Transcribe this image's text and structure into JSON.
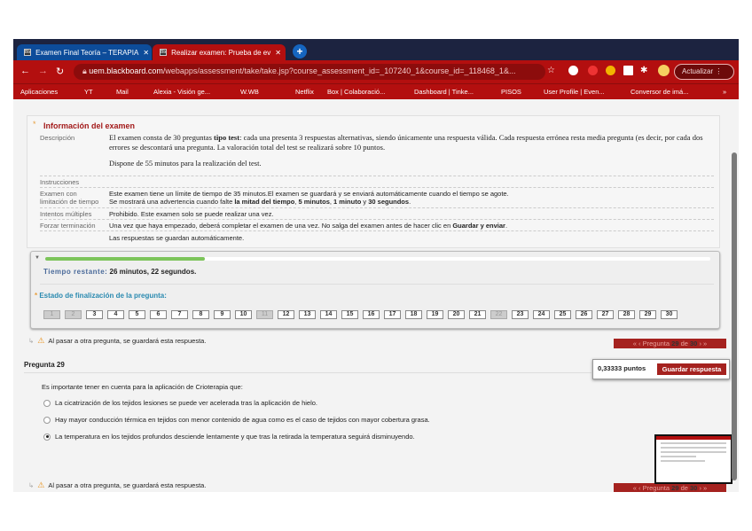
{
  "browser": {
    "tabs": [
      {
        "label": "Examen Final Teoría – TERAPIA",
        "active": false
      },
      {
        "label": "Realizar examen: Prueba de ev",
        "active": true
      }
    ],
    "url_host": "uem.blackboard.com",
    "url_path": "/webapps/assessment/take/take.jsp?course_assessment_id=_107240_1&course_id=_118468_1&...",
    "update_label": "Actualizar",
    "bookmarks": [
      "Aplicaciones",
      "YT",
      "Mail",
      "Alexia - Visión ge...",
      "W.WB",
      "Netflix",
      "Box | Colaboració...",
      "Dashboard | Tinke...",
      "PISOS",
      "User Profile | Even...",
      "Conversor de imá...",
      "»"
    ]
  },
  "info": {
    "title": "Información del examen",
    "desc_label": "Descripción",
    "desc_1a": "El examen consta de 30 preguntas ",
    "desc_1b": "tipo test",
    "desc_1c": ": cada una presenta 3 respuestas alternativas, siendo únicamente una respuesta válida. Cada respuesta errónea resta media pregunta (es decir, por cada dos errores se descontará una pregunta. La valoración total del test se realizará sobre 10 puntos.",
    "desc_2": "Dispone de 55 minutos para la realización del test.",
    "instr_label": "Instrucciones",
    "limit_label_1": "Examen con",
    "limit_label_2": "limitación de tiempo",
    "limit_1": "Este examen tiene un límite de tiempo de 35 minutos.El examen se guardará y se enviará automáticamente cuando el tiempo se agote.",
    "limit_2a": "Se mostrará una advertencia cuando falte ",
    "limit_2b": "la mitad del tiempo",
    "limit_2c": ", ",
    "limit_2d": "5 minutos",
    "limit_2e": ", ",
    "limit_2f": "1 minuto",
    "limit_2g": " y ",
    "limit_2h": "30 segundos",
    "limit_2i": ".",
    "multi_label": "Intentos múltiples",
    "multi": "Prohibido. Este examen solo se puede realizar una vez.",
    "force_label": "Forzar terminación",
    "force_a": "Una vez que haya empezado, deberá completar el examen de una vez. No salga del examen antes de hacer clic en ",
    "force_b": "Guardar y enviar",
    "force_c": ".",
    "auto": "Las respuestas se guardan automáticamente."
  },
  "timer": {
    "label": "Tiempo restante:",
    "min": "26",
    "min_word": " minutos, ",
    "sec": "22",
    "sec_word": " segundos.",
    "progress_fraction": 0.24
  },
  "status": {
    "title": "Estado de finalización de la pregunta:",
    "questions": [
      "1",
      "2",
      "3",
      "4",
      "5",
      "6",
      "7",
      "8",
      "9",
      "10",
      "11",
      "12",
      "13",
      "14",
      "15",
      "16",
      "17",
      "18",
      "19",
      "20",
      "21",
      "22",
      "23",
      "24",
      "25",
      "26",
      "27",
      "28",
      "29",
      "30"
    ],
    "answered": [
      "1",
      "2",
      "11",
      "22"
    ]
  },
  "warning": "Al pasar a otra pregunta, se guardará esta respuesta.",
  "qnav": {
    "first": "«",
    "prev": "‹",
    "pre": "Pregunta ",
    "num": "29",
    "mid": " de ",
    "total": "30",
    "next": "›",
    "last": "»"
  },
  "question": {
    "header": "Pregunta 29",
    "points": "0,33333 puntos",
    "save_label": "Guardar respuesta",
    "text": "Es importante tener en cuenta para la aplicación de Crioterapia que:",
    "options": [
      "La cicatrización de los tejidos lesiones se puede ver acelerada tras la aplicación de hielo.",
      "Hay mayor conducción térmica en tejidos con menor contenido de agua como es el caso de tejidos con mayor cobertura grasa.",
      "La temperatura en los tejidos profundos desciende lentamente y que tras la retirada la temperatura seguirá disminuyendo."
    ],
    "selected": 2
  },
  "colors": {
    "brand_red": "#b30f0f",
    "nav_red": "#a5221f",
    "progress_green": "#7cc45a"
  }
}
